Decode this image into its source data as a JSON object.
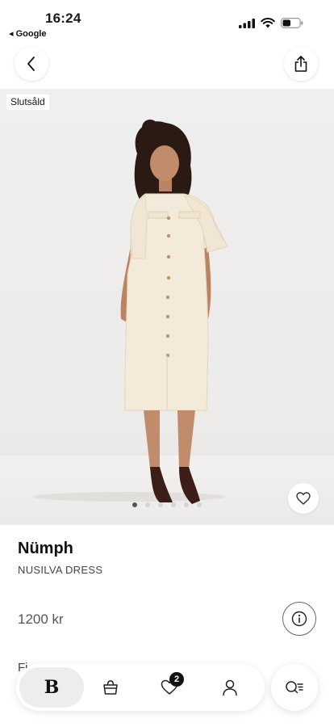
{
  "status_bar": {
    "time": "16:24",
    "back_app": "◂ Google"
  },
  "nav": {
    "back_icon": "chevron-left-icon",
    "share_icon": "share-icon"
  },
  "product": {
    "badge": "Slutsåld",
    "brand": "Nümph",
    "name": "NUSILVA DRESS",
    "price": "1200 kr",
    "image_count": 6,
    "active_image": 0,
    "peek_text": "Fi"
  },
  "tabbar": {
    "home_logo": "B",
    "favorites_count": "2",
    "items": [
      "home-logo",
      "bag-icon",
      "heart-icon",
      "user-icon",
      "search-filter-icon"
    ]
  },
  "colors": {
    "accent": "#111111",
    "background": "#ffffff",
    "dress": "#f3ead9",
    "shoes": "#3b1e17"
  }
}
